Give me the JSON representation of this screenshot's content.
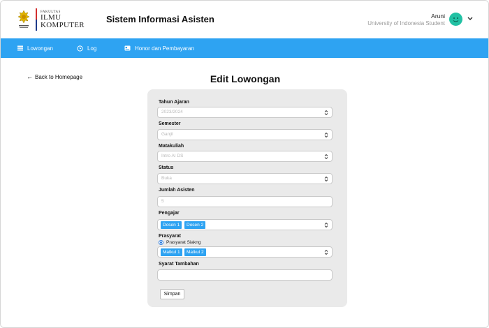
{
  "header": {
    "logo": {
      "small": "FAKULTAS",
      "line1": "ILMU",
      "line2": "KOMPUTER",
      "seal_caption": "UNIVERSITAS INDONESIA"
    },
    "title": "Sistem Informasi Asisten",
    "user": {
      "name": "Aruni",
      "subtitle": "University of Indonesia Student"
    },
    "accent": "#2ea3f2",
    "avatar_color": "#22c1a4"
  },
  "nav": {
    "items": [
      {
        "label": "Lowongan",
        "icon": "list-icon"
      },
      {
        "label": "Log",
        "icon": "clock-icon"
      },
      {
        "label": "Honor dan Pembayaran",
        "icon": "payment-icon"
      }
    ]
  },
  "main": {
    "back_label": "Back to Homepage",
    "title": "Edit Lowongan"
  },
  "form": {
    "tahun_ajaran": {
      "label": "Tahun Ajaran",
      "value": "2023/2024"
    },
    "semester": {
      "label": "Semester",
      "value": "Ganjil"
    },
    "matakuliah": {
      "label": "Matakuliah",
      "value": "Intro AI DS"
    },
    "status": {
      "label": "Status",
      "value": "Buka"
    },
    "jumlah_asisten": {
      "label": "Jumlah Asisten",
      "value": "5"
    },
    "pengajar": {
      "label": "Pengajar",
      "tags": [
        "Dosen 1",
        "Dosen 2"
      ]
    },
    "prasyarat": {
      "label": "Prasyarat",
      "radio_label": "Prasyarat Siakng",
      "tags": [
        "Matkul 1",
        "Matkul 2"
      ]
    },
    "syarat_tambahan": {
      "label": "Syarat Tambahan",
      "value": ""
    },
    "submit_label": "Simpan"
  }
}
